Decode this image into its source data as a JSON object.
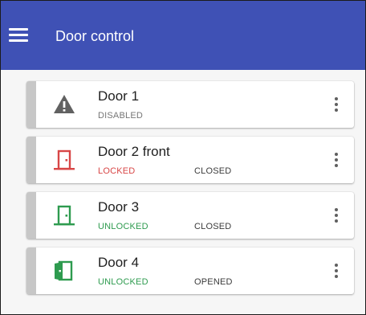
{
  "app": {
    "title": "Door control"
  },
  "colors": {
    "appbar": "#3f51b5",
    "locked": "#d84646",
    "unlocked": "#2e9b4f",
    "disabled": "#757575",
    "warning_icon": "#616161"
  },
  "doors": [
    {
      "name": "Door 1",
      "lock_status": "DISABLED",
      "door_status": "",
      "icon": "warning-icon"
    },
    {
      "name": "Door 2 front",
      "lock_status": "LOCKED",
      "door_status": "CLOSED",
      "icon": "door-closed-icon"
    },
    {
      "name": "Door 3",
      "lock_status": "UNLOCKED",
      "door_status": "CLOSED",
      "icon": "door-closed-icon"
    },
    {
      "name": "Door 4",
      "lock_status": "UNLOCKED",
      "door_status": "OPENED",
      "icon": "door-open-icon"
    }
  ]
}
